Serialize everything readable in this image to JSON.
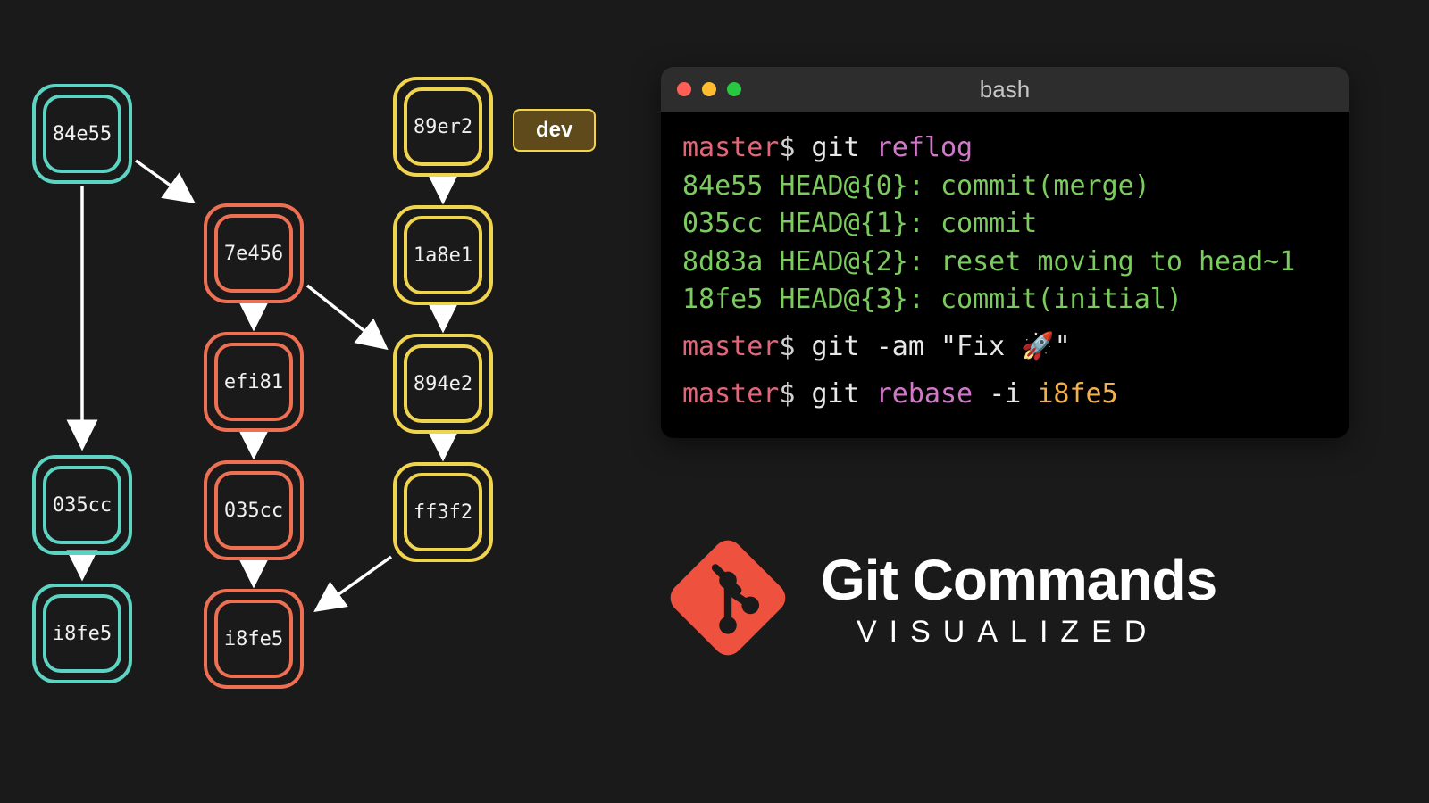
{
  "branches": {
    "dev_label": "dev"
  },
  "nodes": {
    "teal1": "84e55",
    "teal2": "035cc",
    "teal3": "i8fe5",
    "orange1": "7e456",
    "orange2": "efi81",
    "orange3": "035cc",
    "orange4": "i8fe5",
    "yellow1": "89er2",
    "yellow2": "1a8e1",
    "yellow3": "894e2",
    "yellow4": "ff3f2"
  },
  "terminal": {
    "title": "bash",
    "line1": {
      "prompt": "master",
      "dollar": "$",
      "cmd": " git ",
      "sub": "reflog"
    },
    "out1": "84e55 HEAD@{0}: commit(merge)",
    "out2": "035cc HEAD@{1}: commit",
    "out3": "8d83a HEAD@{2}: reset moving to head~1",
    "out4": "18fe5 HEAD@{3}: commit(initial)",
    "line2": {
      "prompt": "master",
      "dollar": "$",
      "cmd": " git ",
      "flag": "-am ",
      "str": "\"Fix 🚀\""
    },
    "line3": {
      "prompt": "master",
      "dollar": "$",
      "cmd": " git ",
      "sub": "rebase ",
      "flag": "-i ",
      "hash": "i8fe5"
    }
  },
  "title": {
    "big": "Git Commands",
    "small": "VISUALIZED"
  }
}
